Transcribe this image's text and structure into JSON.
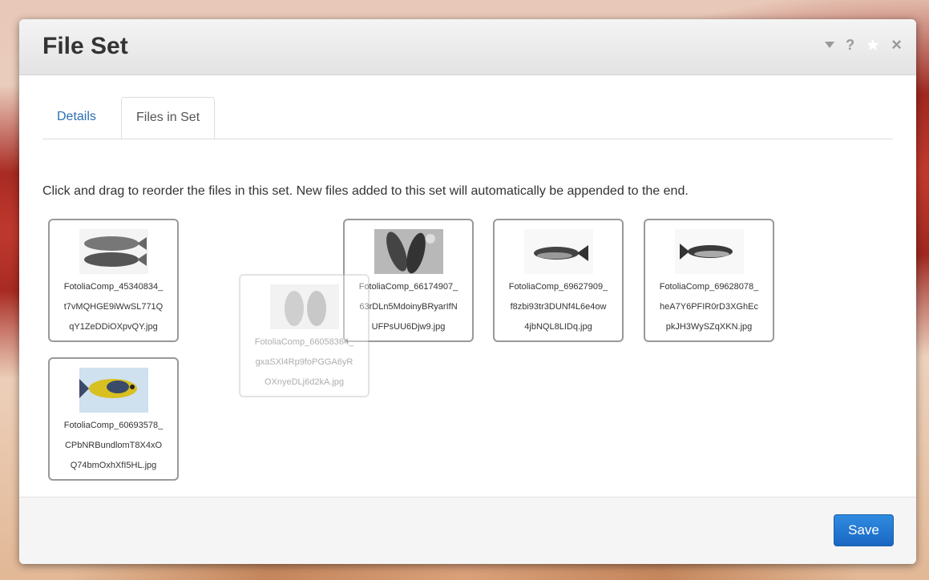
{
  "dialog": {
    "title": "File Set",
    "controls": [
      "dropdown-icon",
      "help-icon",
      "star-icon",
      "close-icon"
    ],
    "help_label": "?",
    "close_label": "×"
  },
  "tabs": [
    {
      "label": "Details",
      "active": false
    },
    {
      "label": "Files in Set",
      "active": true
    }
  ],
  "instructions": "Click and drag to reorder the files in this set. New files added to this set will automatically be appended to the end.",
  "files": [
    {
      "line1": "FotoliaComp_45340834_",
      "line2": "t7vMQHGE9iWwSL771Q",
      "line3": "qY1ZeDDiOXpvQY.jpg",
      "thumb": "two-fish-image"
    },
    {
      "line1": "FotoliaComp_66174907_",
      "line2": "63rDLn5MdoinyBRyarIfN",
      "line3": "UFPsUU6Djw9.jpg",
      "thumb": "fish-on-ice-image"
    },
    {
      "line1": "FotoliaComp_69627909_",
      "line2": "f8zbi93tr3DUNf4L6e4ow",
      "line3": "4jbNQL8LIDq.jpg",
      "thumb": "tuna-image"
    },
    {
      "line1": "FotoliaComp_69628078_",
      "line2": "heA7Y6PFIR0rD3XGhEc",
      "line3": "pkJH3WySZqXKN.jpg",
      "thumb": "tuna-image"
    },
    {
      "line1": "FotoliaComp_60693578_",
      "line2": "CPbNRBundlomT8X4xO",
      "line3": "Q74bmOxhXfI5HL.jpg",
      "thumb": "painted-fish-image"
    },
    {
      "line1": "FotoliaComp_66058364_",
      "line2": "gxaSXl4Rp9foPGGA6yR",
      "line3": "OXnyeDLj6d2kA.jpg",
      "thumb": "fish-sketch-image",
      "dragging": true
    }
  ],
  "footer": {
    "save_label": "Save"
  },
  "colors": {
    "accent": "#2a6fb5",
    "save_button": "#2f8be0",
    "card_border": "#999999"
  }
}
